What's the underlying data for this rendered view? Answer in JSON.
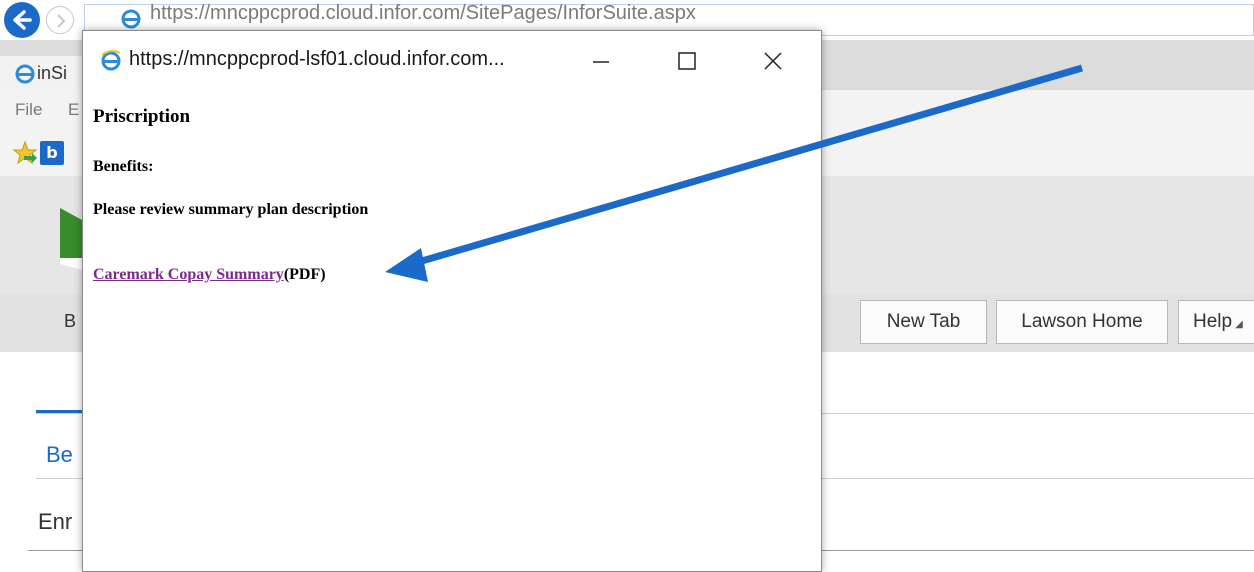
{
  "browser": {
    "url": "https://mncppcprod.cloud.infor.com/SitePages/InforSuite.aspx",
    "tab_label": "inSi",
    "menu": {
      "file_label": "File",
      "edit_label": "E"
    },
    "favorites_bing_label": "b",
    "accent_color": "#1b6ac9"
  },
  "page": {
    "toolbar": {
      "left_label": "B",
      "new_tab_label": "New Tab",
      "lawson_home_label": "Lawson Home",
      "help_label": "Help"
    },
    "section_benefits_label": "Be",
    "section_enrollment_label": "Enr"
  },
  "popup": {
    "title": "https://mncppcprod-lsf01.cloud.infor.com...",
    "heading": "Priscription",
    "benefits_label": "Benefits:",
    "review_text": "Please review summary plan description",
    "link_text": "Caremark Copay Summary",
    "link_suffix": "(PDF)",
    "link_color": "#7b2a8c"
  },
  "annotation": {
    "arrow_color": "#1b6ac9"
  }
}
